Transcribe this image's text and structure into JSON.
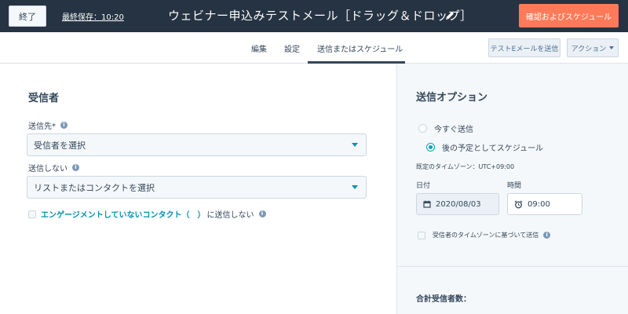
{
  "header": {
    "exit_label": "終了",
    "last_saved": "最終保存：10:20",
    "email_title": "ウェビナー申込みテストメール［ドラッグ＆ドロップ］",
    "review_button": "確認およびスケジュール"
  },
  "tabs": {
    "items": [
      {
        "label": "編集"
      },
      {
        "label": "設定"
      },
      {
        "label": "送信またはスケジュール"
      }
    ],
    "active": "送信またはスケジュール",
    "test_email_button": "テストEメールを送信",
    "actions_button": "アクション"
  },
  "recipients": {
    "title": "受信者",
    "send_to_label": "送信先*",
    "send_to_placeholder": "受信者を選択",
    "dont_send_label": "送信しない",
    "dont_send_placeholder": "リストまたはコンタクトを選択",
    "unengaged_link": "エンゲージメントしていないコンタクト（　）",
    "unengaged_tail": "に送信しない"
  },
  "send_options": {
    "title": "送信オプション",
    "options": [
      {
        "label": "今すぐ送信",
        "selected": false
      },
      {
        "label": "後の予定としてスケジュール",
        "selected": true
      }
    ],
    "timezone_text": "既定のタイムゾーン：UTC+09:00",
    "date_label": "日付",
    "date_value": "2020/08/03",
    "time_label": "時間",
    "time_value": "09:00",
    "recipient_tz_label": "受信者のタイムゾーンに基づいて送信",
    "total_label": "合計受信者数："
  },
  "colors": {
    "header_bg": "#253342",
    "accent_orange": "#ff7a59",
    "link_teal": "#0091ae",
    "radio_teal": "#00a4bd"
  }
}
